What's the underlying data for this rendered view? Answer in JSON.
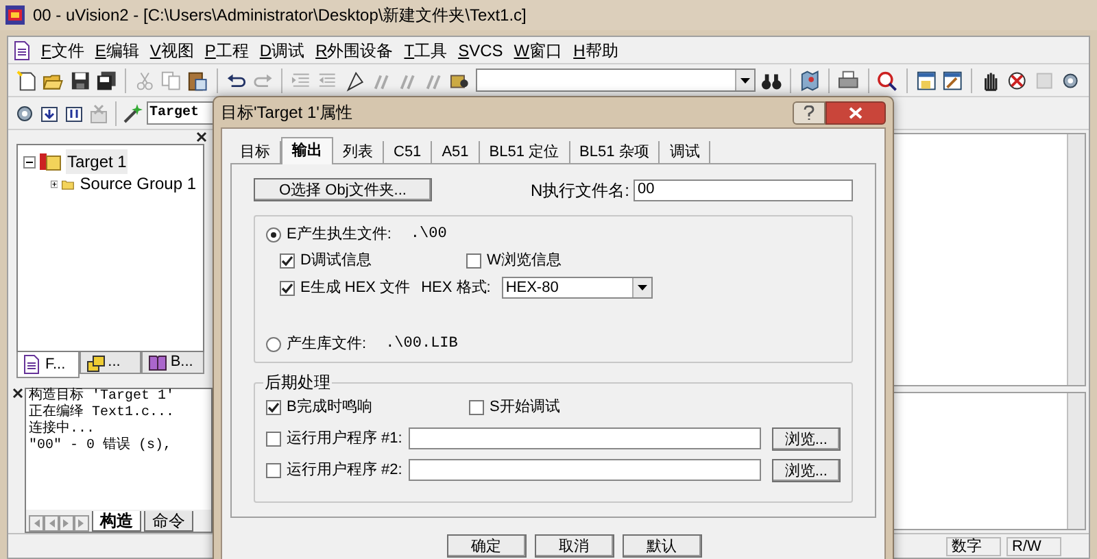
{
  "window": {
    "title": "00  - uVision2 - [C:\\Users\\Administrator\\Desktop\\新建文件夹\\Text1.c]"
  },
  "menu": [
    {
      "mnemonic": "F",
      "label": "文件"
    },
    {
      "mnemonic": "E",
      "label": "编辑"
    },
    {
      "mnemonic": "V",
      "label": "视图"
    },
    {
      "mnemonic": "P",
      "label": "工程"
    },
    {
      "mnemonic": "D",
      "label": "调试"
    },
    {
      "mnemonic": "R",
      "label": "外围设备"
    },
    {
      "mnemonic": "T",
      "label": "工具"
    },
    {
      "mnemonic": "S",
      "label": "VCS"
    },
    {
      "mnemonic": "W",
      "label": "窗口"
    },
    {
      "mnemonic": "H",
      "label": "帮助"
    }
  ],
  "target_combo": "Target",
  "project_tree": [
    {
      "label": "Target 1",
      "expanded": true,
      "children": [
        {
          "label": "Source Group 1",
          "expanded": false
        }
      ]
    }
  ],
  "project_tabs": [
    {
      "label": "F...",
      "selected": true
    },
    {
      "label": "...",
      "selected": false
    },
    {
      "label": "B...",
      "selected": false
    }
  ],
  "output_lines": [
    "构造目标 'Target 1'",
    "正在编绎 Text1.c...",
    "连接中...",
    "\"00\" - 0 错误 (s),"
  ],
  "output_tabs": [
    {
      "label": "构造",
      "selected": true
    },
    {
      "label": "命令",
      "selected": false
    }
  ],
  "status_bar": [
    "数字",
    "R/W"
  ],
  "dialog": {
    "title": "目标'Target 1'属性",
    "tabs": [
      {
        "label": "目标",
        "selected": false
      },
      {
        "label": "输出",
        "selected": true
      },
      {
        "label": "列表",
        "selected": false
      },
      {
        "label": "C51",
        "selected": false
      },
      {
        "label": "A51",
        "selected": false
      },
      {
        "label": "BL51 定位",
        "selected": false
      },
      {
        "label": "BL51 杂项",
        "selected": false
      },
      {
        "label": "调试",
        "selected": false
      }
    ],
    "obj_folder_button": "O选择 Obj文件夹...",
    "exe_name_label": "N执行文件名:",
    "exe_name": "00",
    "create_exe": {
      "label": "E产生执生文件:",
      "path": ".\\00",
      "selected": true
    },
    "debug_info": {
      "label": "D调试信息",
      "checked": true
    },
    "browse_info": {
      "label": "W浏览信息",
      "checked": false
    },
    "create_hex": {
      "label": "E生成 HEX 文件",
      "checked": true
    },
    "hex_format_label": "HEX 格式:",
    "hex_format": "HEX-80",
    "create_lib": {
      "label": "产生库文件:",
      "path": ".\\00.LIB",
      "selected": false
    },
    "post_title": "后期处理",
    "beep": {
      "label": "B完成时鸣响",
      "checked": true
    },
    "start_debug": {
      "label": "S开始调试",
      "checked": false
    },
    "run_programs": [
      {
        "label": "运行用户程序 #1:",
        "checked": false,
        "browse": "浏览..."
      },
      {
        "label": "运行用户程序 #2:",
        "checked": false,
        "browse": "浏览..."
      }
    ],
    "buttons": [
      "确定",
      "取消",
      "默认"
    ]
  }
}
